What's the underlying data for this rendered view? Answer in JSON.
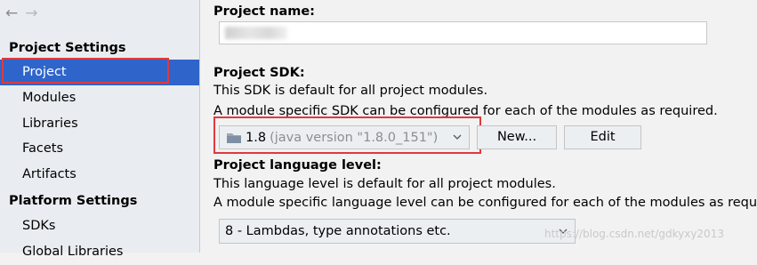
{
  "sidebar": {
    "nav": {
      "back": "←",
      "forward": "→"
    },
    "project_settings_heading": "Project Settings",
    "project_settings_items": [
      "Project",
      "Modules",
      "Libraries",
      "Facets",
      "Artifacts"
    ],
    "selected_item": "Project",
    "platform_settings_heading": "Platform Settings",
    "platform_settings_items": [
      "SDKs",
      "Global Libraries"
    ]
  },
  "main": {
    "project_name": {
      "label": "Project name:",
      "value": ""
    },
    "project_sdk": {
      "label": "Project SDK:",
      "desc1": "This SDK is default for all project modules.",
      "desc2": "A module specific SDK can be configured for each of the modules as required.",
      "selected_version": "1.8",
      "selected_detail": "(java version \"1.8.0_151\")",
      "new_button": "New...",
      "edit_button": "Edit"
    },
    "language_level": {
      "label": "Project language level:",
      "desc1": "This language level is default for all project modules.",
      "desc2": "A module specific language level can be configured for each of the modules as requi",
      "selected": "8 - Lambdas, type annotations etc."
    }
  },
  "watermark": "https://blog.csdn.net/gdkyxy2013",
  "colors": {
    "selection": "#2f65ca",
    "highlight_border": "#e0393e",
    "sidebar_bg": "#e9edf1",
    "panel_bg": "#f2f2f2"
  }
}
